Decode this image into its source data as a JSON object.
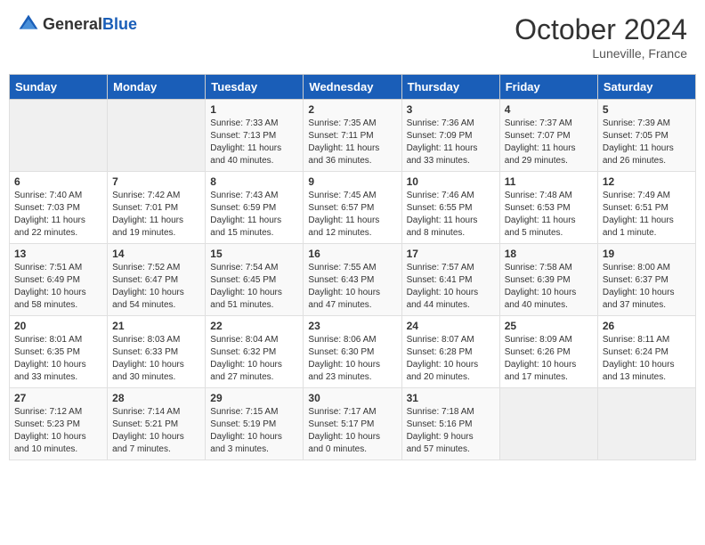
{
  "header": {
    "logo_general": "General",
    "logo_blue": "Blue",
    "month": "October 2024",
    "location": "Luneville, France"
  },
  "days_of_week": [
    "Sunday",
    "Monday",
    "Tuesday",
    "Wednesday",
    "Thursday",
    "Friday",
    "Saturday"
  ],
  "weeks": [
    [
      {
        "day": "",
        "info": ""
      },
      {
        "day": "",
        "info": ""
      },
      {
        "day": "1",
        "info": "Sunrise: 7:33 AM\nSunset: 7:13 PM\nDaylight: 11 hours\nand 40 minutes."
      },
      {
        "day": "2",
        "info": "Sunrise: 7:35 AM\nSunset: 7:11 PM\nDaylight: 11 hours\nand 36 minutes."
      },
      {
        "day": "3",
        "info": "Sunrise: 7:36 AM\nSunset: 7:09 PM\nDaylight: 11 hours\nand 33 minutes."
      },
      {
        "day": "4",
        "info": "Sunrise: 7:37 AM\nSunset: 7:07 PM\nDaylight: 11 hours\nand 29 minutes."
      },
      {
        "day": "5",
        "info": "Sunrise: 7:39 AM\nSunset: 7:05 PM\nDaylight: 11 hours\nand 26 minutes."
      }
    ],
    [
      {
        "day": "6",
        "info": "Sunrise: 7:40 AM\nSunset: 7:03 PM\nDaylight: 11 hours\nand 22 minutes."
      },
      {
        "day": "7",
        "info": "Sunrise: 7:42 AM\nSunset: 7:01 PM\nDaylight: 11 hours\nand 19 minutes."
      },
      {
        "day": "8",
        "info": "Sunrise: 7:43 AM\nSunset: 6:59 PM\nDaylight: 11 hours\nand 15 minutes."
      },
      {
        "day": "9",
        "info": "Sunrise: 7:45 AM\nSunset: 6:57 PM\nDaylight: 11 hours\nand 12 minutes."
      },
      {
        "day": "10",
        "info": "Sunrise: 7:46 AM\nSunset: 6:55 PM\nDaylight: 11 hours\nand 8 minutes."
      },
      {
        "day": "11",
        "info": "Sunrise: 7:48 AM\nSunset: 6:53 PM\nDaylight: 11 hours\nand 5 minutes."
      },
      {
        "day": "12",
        "info": "Sunrise: 7:49 AM\nSunset: 6:51 PM\nDaylight: 11 hours\nand 1 minute."
      }
    ],
    [
      {
        "day": "13",
        "info": "Sunrise: 7:51 AM\nSunset: 6:49 PM\nDaylight: 10 hours\nand 58 minutes."
      },
      {
        "day": "14",
        "info": "Sunrise: 7:52 AM\nSunset: 6:47 PM\nDaylight: 10 hours\nand 54 minutes."
      },
      {
        "day": "15",
        "info": "Sunrise: 7:54 AM\nSunset: 6:45 PM\nDaylight: 10 hours\nand 51 minutes."
      },
      {
        "day": "16",
        "info": "Sunrise: 7:55 AM\nSunset: 6:43 PM\nDaylight: 10 hours\nand 47 minutes."
      },
      {
        "day": "17",
        "info": "Sunrise: 7:57 AM\nSunset: 6:41 PM\nDaylight: 10 hours\nand 44 minutes."
      },
      {
        "day": "18",
        "info": "Sunrise: 7:58 AM\nSunset: 6:39 PM\nDaylight: 10 hours\nand 40 minutes."
      },
      {
        "day": "19",
        "info": "Sunrise: 8:00 AM\nSunset: 6:37 PM\nDaylight: 10 hours\nand 37 minutes."
      }
    ],
    [
      {
        "day": "20",
        "info": "Sunrise: 8:01 AM\nSunset: 6:35 PM\nDaylight: 10 hours\nand 33 minutes."
      },
      {
        "day": "21",
        "info": "Sunrise: 8:03 AM\nSunset: 6:33 PM\nDaylight: 10 hours\nand 30 minutes."
      },
      {
        "day": "22",
        "info": "Sunrise: 8:04 AM\nSunset: 6:32 PM\nDaylight: 10 hours\nand 27 minutes."
      },
      {
        "day": "23",
        "info": "Sunrise: 8:06 AM\nSunset: 6:30 PM\nDaylight: 10 hours\nand 23 minutes."
      },
      {
        "day": "24",
        "info": "Sunrise: 8:07 AM\nSunset: 6:28 PM\nDaylight: 10 hours\nand 20 minutes."
      },
      {
        "day": "25",
        "info": "Sunrise: 8:09 AM\nSunset: 6:26 PM\nDaylight: 10 hours\nand 17 minutes."
      },
      {
        "day": "26",
        "info": "Sunrise: 8:11 AM\nSunset: 6:24 PM\nDaylight: 10 hours\nand 13 minutes."
      }
    ],
    [
      {
        "day": "27",
        "info": "Sunrise: 7:12 AM\nSunset: 5:23 PM\nDaylight: 10 hours\nand 10 minutes."
      },
      {
        "day": "28",
        "info": "Sunrise: 7:14 AM\nSunset: 5:21 PM\nDaylight: 10 hours\nand 7 minutes."
      },
      {
        "day": "29",
        "info": "Sunrise: 7:15 AM\nSunset: 5:19 PM\nDaylight: 10 hours\nand 3 minutes."
      },
      {
        "day": "30",
        "info": "Sunrise: 7:17 AM\nSunset: 5:17 PM\nDaylight: 10 hours\nand 0 minutes."
      },
      {
        "day": "31",
        "info": "Sunrise: 7:18 AM\nSunset: 5:16 PM\nDaylight: 9 hours\nand 57 minutes."
      },
      {
        "day": "",
        "info": ""
      },
      {
        "day": "",
        "info": ""
      }
    ]
  ]
}
